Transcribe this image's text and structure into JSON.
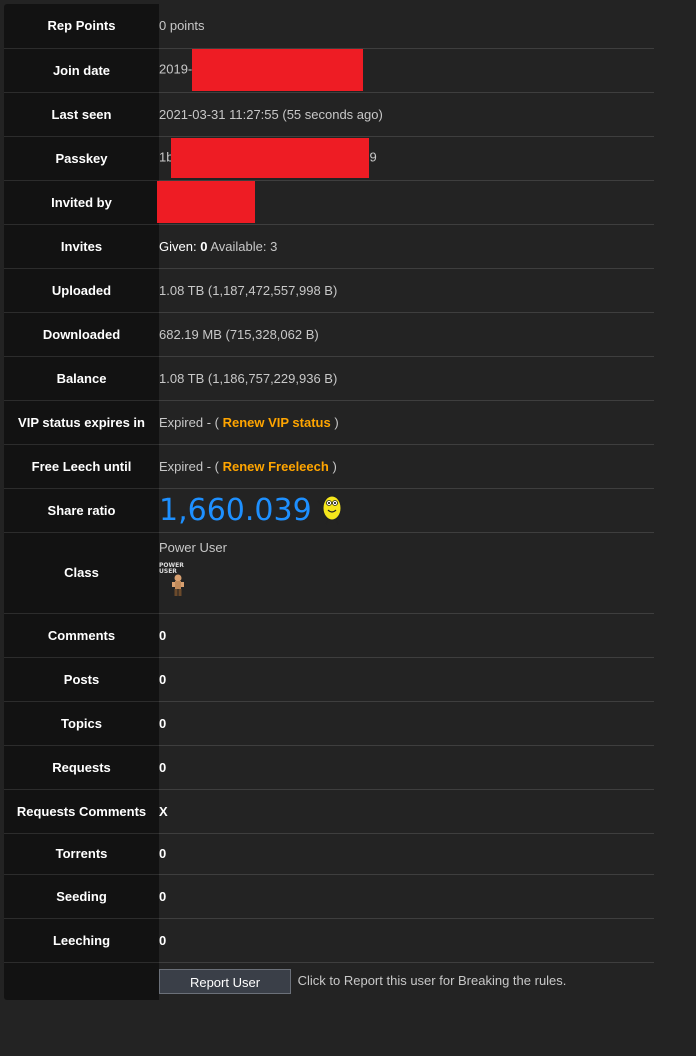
{
  "rows": {
    "rep_points": {
      "label": "Rep Points",
      "value": "0 points"
    },
    "join_date": {
      "label": "Join date",
      "value": "2019-"
    },
    "last_seen": {
      "label": "Last seen",
      "value": "2021-03-31 11:27:55 (55 seconds ago)"
    },
    "passkey": {
      "label": "Passkey",
      "prefix": "1b",
      "suffix": "9"
    },
    "invited_by": {
      "label": "Invited by"
    },
    "invites": {
      "label": "Invites",
      "given_label": "Given:",
      "given_value": "0",
      "available_label": "Available:",
      "available_value": "3"
    },
    "uploaded": {
      "label": "Uploaded",
      "value": "1.08 TB (1,187,472,557,998 B)"
    },
    "downloaded": {
      "label": "Downloaded",
      "value": "682.19 MB (715,328,062 B)"
    },
    "balance": {
      "label": "Balance",
      "value": "1.08 TB (1,186,757,229,936 B)"
    },
    "vip": {
      "label": "VIP status expires in",
      "prefix": "Expired - (",
      "link": "Renew VIP status",
      "suffix": ")"
    },
    "freeleech": {
      "label": "Free Leech until",
      "prefix": "Expired - (",
      "link": "Renew Freeleech",
      "suffix": ")"
    },
    "share_ratio": {
      "label": "Share ratio",
      "value": "1,660.039"
    },
    "class": {
      "label": "Class",
      "value": "Power User",
      "badge_text": "POWER USER"
    },
    "comments": {
      "label": "Comments",
      "value": "0"
    },
    "posts": {
      "label": "Posts",
      "value": "0"
    },
    "topics": {
      "label": "Topics",
      "value": "0"
    },
    "requests": {
      "label": "Requests",
      "value": "0"
    },
    "requests_comments": {
      "label": "Requests Comments",
      "value": "X"
    },
    "torrents": {
      "label": "Torrents",
      "value": "0"
    },
    "seeding": {
      "label": "Seeding",
      "value": "0"
    },
    "leeching": {
      "label": "Leeching",
      "value": "0"
    },
    "report": {
      "button": "Report User",
      "text": "Click to Report this user for Breaking the rules."
    }
  },
  "colors": {
    "label_bg": "#121212",
    "page_bg": "#232323",
    "link": "#ffa500",
    "ratio": "#1e90ff",
    "redaction": "#ee1c24"
  }
}
